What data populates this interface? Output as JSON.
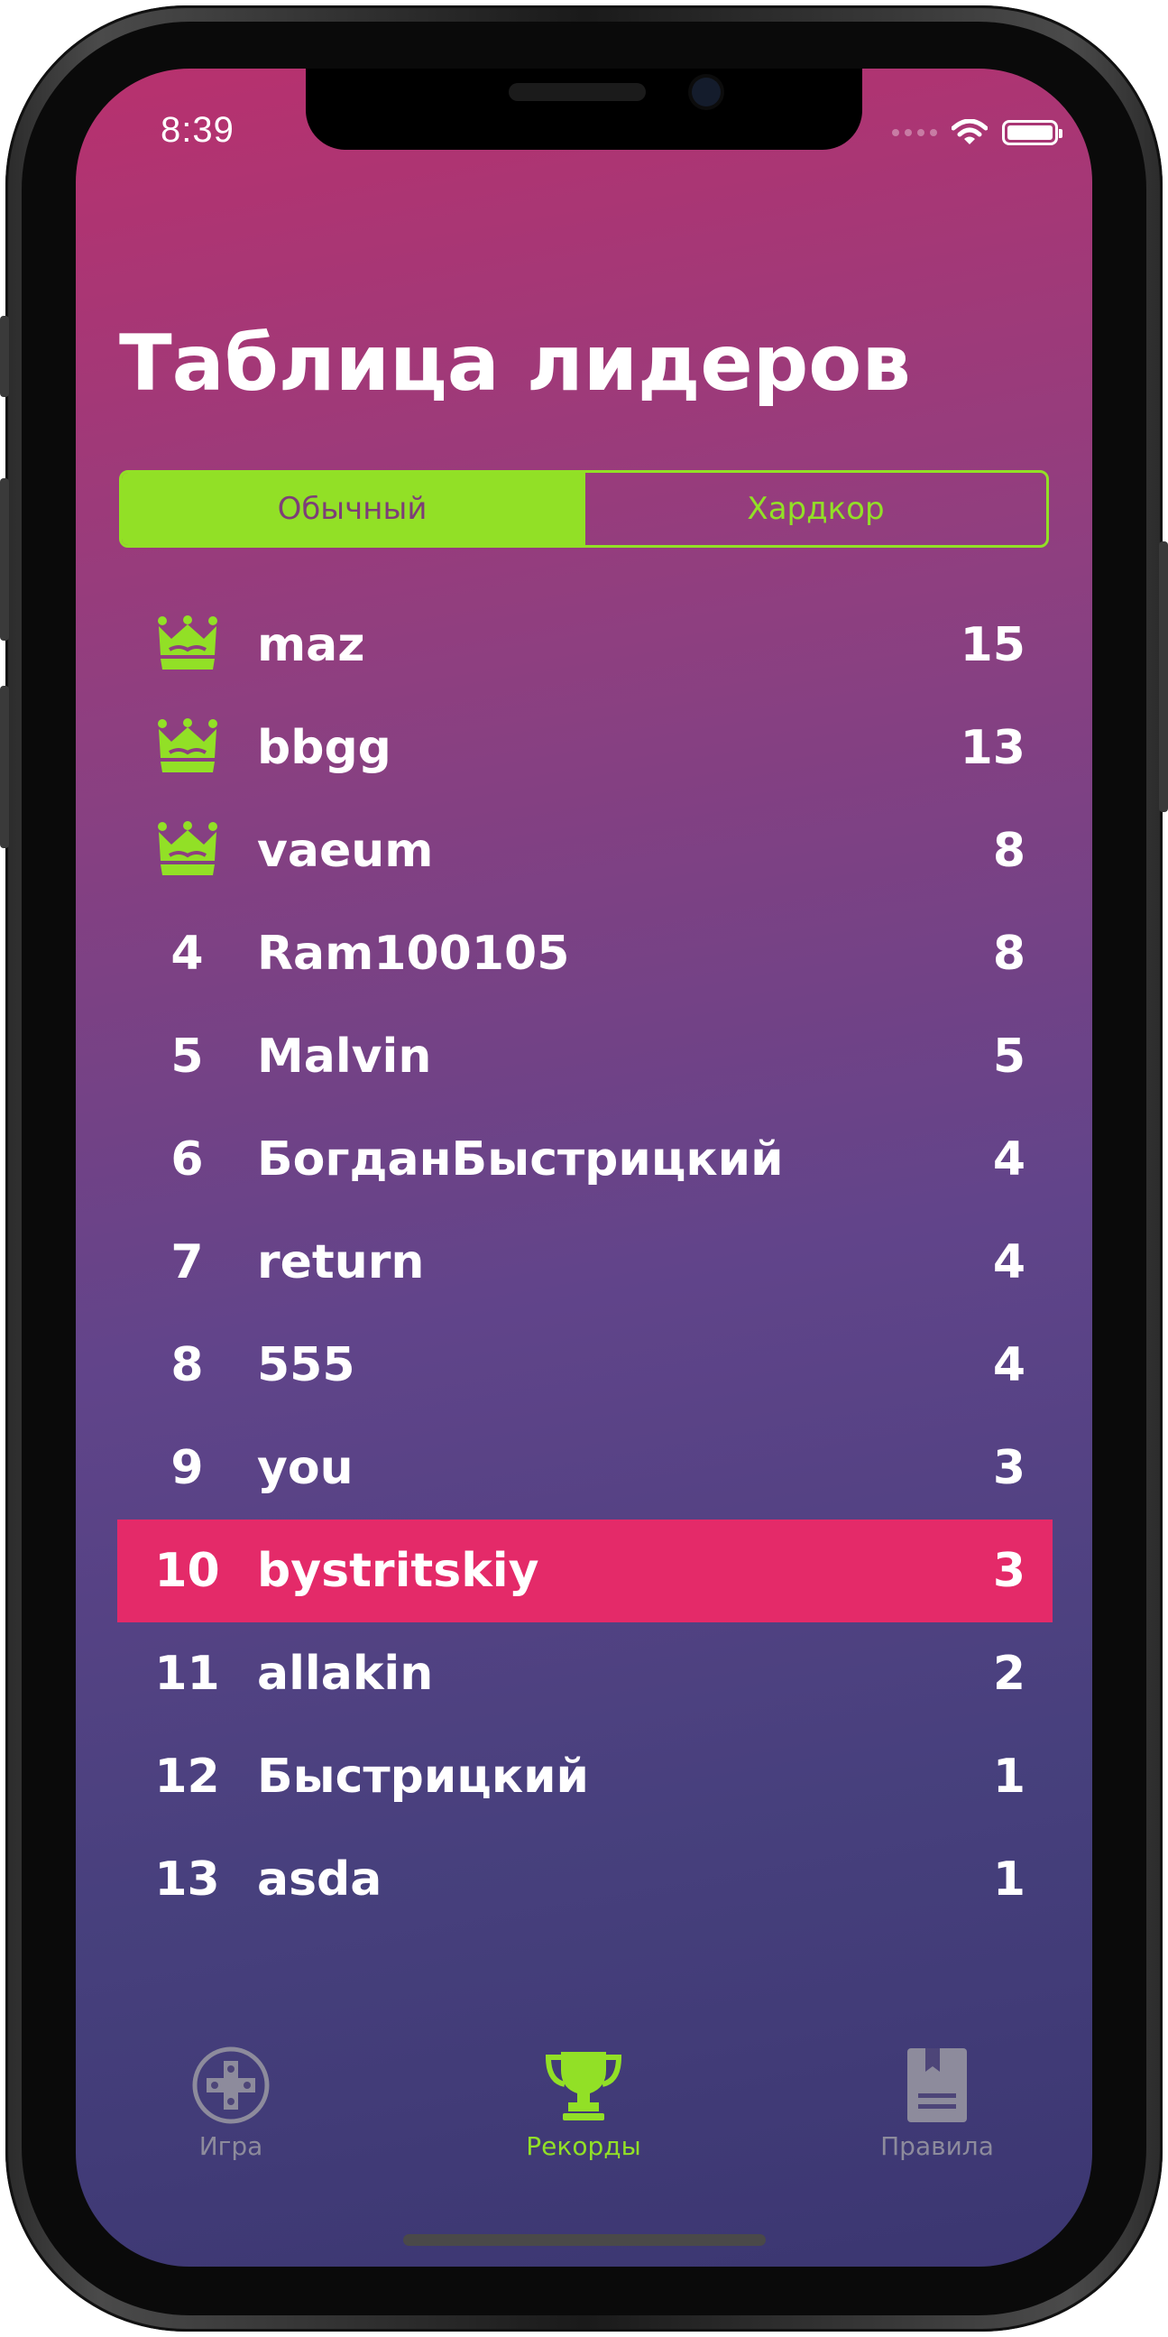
{
  "status_bar": {
    "time": "8:39",
    "wifi_icon": "wifi-icon",
    "battery_icon": "battery-icon"
  },
  "header": {
    "title": "Таблица лидеров"
  },
  "segmented": {
    "options": [
      "Обычный",
      "Хардкор"
    ],
    "selected": "Обычный",
    "accent_color": "#92e026"
  },
  "leaderboard": {
    "highlight_color": "#e42a69",
    "rows": [
      {
        "rank": "",
        "icon": "crown-icon",
        "name": "maz",
        "score": "15"
      },
      {
        "rank": "",
        "icon": "crown-icon",
        "name": "bbgg",
        "score": "13"
      },
      {
        "rank": "",
        "icon": "crown-icon",
        "name": "vaeum",
        "score": "8"
      },
      {
        "rank": "4",
        "name": "Ram100105",
        "score": "8"
      },
      {
        "rank": "5",
        "name": "Malvin",
        "score": "5"
      },
      {
        "rank": "6",
        "name": "БогданБыстрицкий",
        "score": "4"
      },
      {
        "rank": "7",
        "name": "return",
        "score": "4"
      },
      {
        "rank": "8",
        "name": "555",
        "score": "4"
      },
      {
        "rank": "9",
        "name": "you",
        "score": "3"
      },
      {
        "rank": "10",
        "name": "bystritskiy",
        "score": "3",
        "highlighted": true
      },
      {
        "rank": "11",
        "name": "allakin",
        "score": "2"
      },
      {
        "rank": "12",
        "name": "Быстрицкий",
        "score": "1"
      },
      {
        "rank": "13",
        "name": "asda",
        "score": "1"
      }
    ]
  },
  "tabbar": {
    "tabs": [
      {
        "label": "Игра",
        "icon": "gamepad-icon",
        "active": false
      },
      {
        "label": "Рекорды",
        "icon": "trophy-icon",
        "active": true
      },
      {
        "label": "Правила",
        "icon": "book-icon",
        "active": false
      }
    ]
  }
}
